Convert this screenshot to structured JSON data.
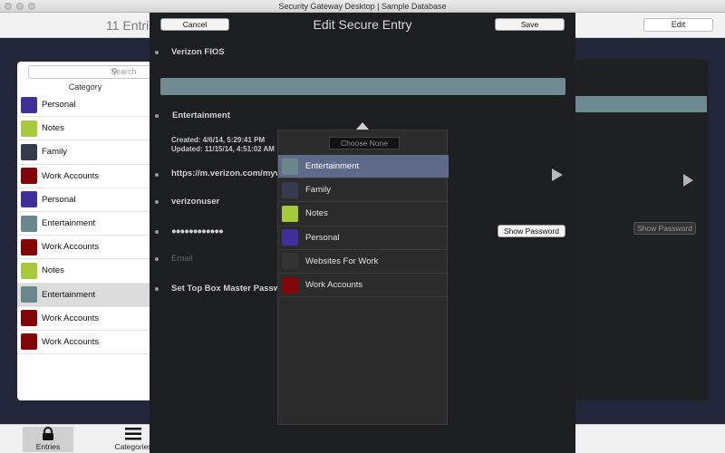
{
  "window": {
    "title": "Security Gateway Desktop | Sample Database"
  },
  "toolbar": {
    "entry_count": "11 Entri",
    "edit_label": "Edit"
  },
  "sidebar": {
    "search_placeholder": "Search",
    "category_header": "Category",
    "items": [
      {
        "label": "Personal",
        "color": "#3e2f9b"
      },
      {
        "label": "Notes",
        "color": "#a7c93c"
      },
      {
        "label": "Family",
        "color": "#353a4d"
      },
      {
        "label": "Work Accounts",
        "color": "#820508"
      },
      {
        "label": "Personal",
        "color": "#3e2f9b"
      },
      {
        "label": "Entertainment",
        "color": "#6a878b"
      },
      {
        "label": "Work Accounts",
        "color": "#820508"
      },
      {
        "label": "Notes",
        "color": "#a7c93c"
      },
      {
        "label": "Entertainment",
        "color": "#6a878b",
        "selected": true
      },
      {
        "label": "Work Accounts",
        "color": "#820508"
      },
      {
        "label": "Work Accounts",
        "color": "#820508"
      }
    ]
  },
  "modal": {
    "title": "Edit Secure Entry",
    "cancel_label": "Cancel",
    "save_label": "Save",
    "entry_name": "Verizon FIOS",
    "category_value": "Entertainment",
    "created": "Created: 4/6/14, 5:29:41 PM",
    "updated": "Updated: 11/15/14, 4:51:02 AM",
    "url": "https://m.verizon.com/myv",
    "username": "verizonuser",
    "password_mask": "●●●●●●●●●●●●",
    "show_password_label": "Show Password",
    "email_placeholder": "Email",
    "note_title": "Set Top Box Master Passw"
  },
  "category_popover": {
    "choose_none_label": "Choose None",
    "options": [
      {
        "label": "Entertainment",
        "color": "#6a878b",
        "selected": true
      },
      {
        "label": "Family",
        "color": "#353a4d"
      },
      {
        "label": "Notes",
        "color": "#a7c93c"
      },
      {
        "label": "Personal",
        "color": "#3e2f9b"
      },
      {
        "label": "Websites For Work",
        "color": "#333333"
      },
      {
        "label": "Work Accounts",
        "color": "#820508"
      }
    ]
  },
  "right_panel": {
    "show_password_label": "Show Password"
  },
  "tabbar": {
    "entries_label": "Entries",
    "entries_icon": "lock-icon",
    "categories_label": "Categories",
    "categories_icon": "list-icon"
  }
}
